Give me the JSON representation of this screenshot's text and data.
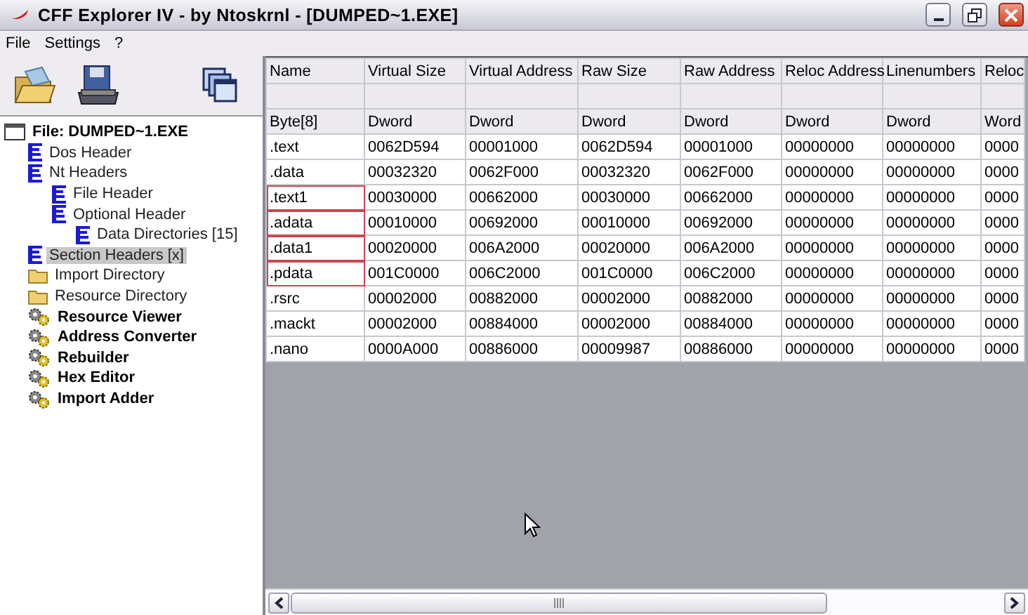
{
  "window": {
    "title": "CFF Explorer IV - by Ntoskrnl - [DUMPED~1.EXE]"
  },
  "menu": [
    "File",
    "Settings",
    "?"
  ],
  "tree": [
    {
      "label": "File: DUMPED~1.EXE",
      "kind": "file",
      "selected": false,
      "children": [
        {
          "label": "Dos Header",
          "kind": "header",
          "selected": false
        },
        {
          "label": "Nt Headers",
          "kind": "header",
          "selected": false,
          "children": [
            {
              "label": "File Header",
              "kind": "header",
              "selected": false
            },
            {
              "label": "Optional Header",
              "kind": "header",
              "selected": false,
              "children": [
                {
                  "label": "Data Directories [15]",
                  "kind": "header",
                  "selected": false
                }
              ]
            }
          ]
        },
        {
          "label": "Section Headers [x]",
          "kind": "header",
          "selected": true
        },
        {
          "label": "Import Directory",
          "kind": "folder",
          "selected": false
        },
        {
          "label": "Resource Directory",
          "kind": "folder",
          "selected": false
        },
        {
          "label": "Resource Viewer",
          "kind": "tool",
          "selected": false
        },
        {
          "label": "Address Converter",
          "kind": "tool",
          "selected": false
        },
        {
          "label": "Rebuilder",
          "kind": "tool",
          "selected": false
        },
        {
          "label": "Hex Editor",
          "kind": "tool",
          "selected": false
        },
        {
          "label": "Import Adder",
          "kind": "tool",
          "selected": false
        }
      ]
    }
  ],
  "table": {
    "columns": [
      {
        "label": "Name",
        "type": "Byte[8]"
      },
      {
        "label": "Virtual Size",
        "type": "Dword"
      },
      {
        "label": "Virtual Address",
        "type": "Dword"
      },
      {
        "label": "Raw Size",
        "type": "Dword"
      },
      {
        "label": "Raw Address",
        "type": "Dword"
      },
      {
        "label": "Reloc Address",
        "type": "Dword"
      },
      {
        "label": "Linenumbers",
        "type": "Dword"
      },
      {
        "label": "Reloc",
        "type": "Word"
      }
    ],
    "rows": [
      {
        "marked": false,
        "cells": [
          ".text",
          "0062D594",
          "00001000",
          "0062D594",
          "00001000",
          "00000000",
          "00000000",
          "0000"
        ]
      },
      {
        "marked": false,
        "cells": [
          ".data",
          "00032320",
          "0062F000",
          "00032320",
          "0062F000",
          "00000000",
          "00000000",
          "0000"
        ]
      },
      {
        "marked": true,
        "cells": [
          ".text1",
          "00030000",
          "00662000",
          "00030000",
          "00662000",
          "00000000",
          "00000000",
          "0000"
        ]
      },
      {
        "marked": true,
        "cells": [
          ".adata",
          "00010000",
          "00692000",
          "00010000",
          "00692000",
          "00000000",
          "00000000",
          "0000"
        ]
      },
      {
        "marked": true,
        "cells": [
          ".data1",
          "00020000",
          "006A2000",
          "00020000",
          "006A2000",
          "00000000",
          "00000000",
          "0000"
        ]
      },
      {
        "marked": true,
        "cells": [
          ".pdata",
          "001C0000",
          "006C2000",
          "001C0000",
          "006C2000",
          "00000000",
          "00000000",
          "0000"
        ]
      },
      {
        "marked": false,
        "cells": [
          ".rsrc",
          "00002000",
          "00882000",
          "00002000",
          "00882000",
          "00000000",
          "00000000",
          "0000"
        ]
      },
      {
        "marked": false,
        "cells": [
          ".mackt",
          "00002000",
          "00884000",
          "00002000",
          "00884000",
          "00000000",
          "00000000",
          "0000"
        ]
      },
      {
        "marked": false,
        "cells": [
          ".nano",
          "0000A000",
          "00886000",
          "00009987",
          "00886000",
          "00000000",
          "00000000",
          "0000"
        ]
      }
    ]
  }
}
